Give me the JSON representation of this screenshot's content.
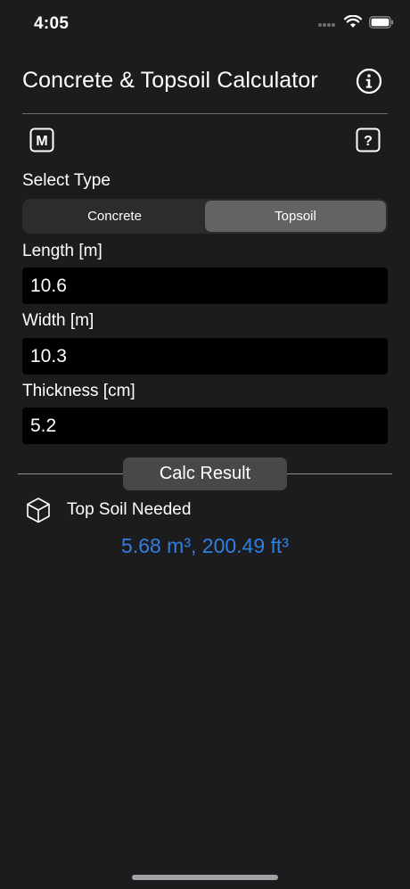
{
  "status_bar": {
    "time": "4:05",
    "icons": [
      "signal-dots-icon",
      "wifi-icon",
      "battery-icon"
    ]
  },
  "header": {
    "title": "Concrete & Topsoil Calculator",
    "info_icon": "info-circle-icon"
  },
  "toolbar": {
    "units_label": "M",
    "help_label": "?"
  },
  "type_selector": {
    "label": "Select Type",
    "options": [
      "Concrete",
      "Topsoil"
    ],
    "selected": "Topsoil"
  },
  "fields": {
    "length": {
      "label": "Length [m]",
      "value": "10.6"
    },
    "width": {
      "label": "Width [m]",
      "value": "10.3"
    },
    "thickness": {
      "label": "Thickness [cm]",
      "value": "5.2"
    }
  },
  "calc_button": {
    "label": "Calc Result"
  },
  "result": {
    "icon": "cube-icon",
    "label": "Top Soil Needed",
    "value": "5.68 m³, 200.49 ft³"
  },
  "colors": {
    "background": "#1c1c1e",
    "field_background": "#000000",
    "segment_selected": "#636366",
    "result_accent": "#2f7fe0",
    "button_background": "#48484a"
  }
}
